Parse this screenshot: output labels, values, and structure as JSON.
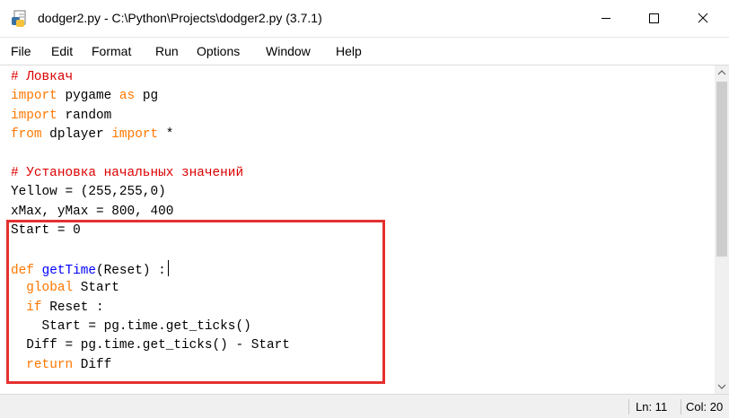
{
  "window": {
    "title": "dodger2.py - C:\\Python\\Projects\\dodger2.py (3.7.1)",
    "controls": {
      "minimize": "minimize",
      "maximize": "maximize",
      "close": "close"
    }
  },
  "menu": {
    "items": [
      "File",
      "Edit",
      "Format",
      "Run",
      "Options",
      "Window",
      "Help"
    ]
  },
  "editor": {
    "lines": [
      [
        {
          "t": "# Ловкач",
          "c": "cm"
        }
      ],
      [
        {
          "t": "import",
          "c": "kw"
        },
        {
          "t": " pygame "
        },
        {
          "t": "as",
          "c": "kw"
        },
        {
          "t": " pg"
        }
      ],
      [
        {
          "t": "import",
          "c": "kw"
        },
        {
          "t": " random"
        }
      ],
      [
        {
          "t": "from",
          "c": "kw"
        },
        {
          "t": " dplayer "
        },
        {
          "t": "import",
          "c": "kw"
        },
        {
          "t": " *"
        }
      ],
      [
        {
          "t": ""
        }
      ],
      [
        {
          "t": "# Установка начальных значений",
          "c": "cm"
        }
      ],
      [
        {
          "t": "Yellow = (255,255,0)"
        }
      ],
      [
        {
          "t": "xMax, yMax = 800, 400"
        }
      ],
      [
        {
          "t": "Start = 0"
        }
      ],
      [
        {
          "t": ""
        }
      ],
      [
        {
          "t": "def",
          "c": "kw"
        },
        {
          "t": " "
        },
        {
          "t": "getTime",
          "c": "fn"
        },
        {
          "t": "(Reset) :"
        },
        {
          "caret": true
        }
      ],
      [
        {
          "t": "  "
        },
        {
          "t": "global",
          "c": "kw"
        },
        {
          "t": " Start"
        }
      ],
      [
        {
          "t": "  "
        },
        {
          "t": "if",
          "c": "kw"
        },
        {
          "t": " Reset :"
        }
      ],
      [
        {
          "t": "    Start = pg.time.get_ticks()"
        }
      ],
      [
        {
          "t": "  Diff = pg.time.get_ticks() - Start"
        }
      ],
      [
        {
          "t": "  "
        },
        {
          "t": "return",
          "c": "kw"
        },
        {
          "t": " Diff"
        }
      ]
    ],
    "colors": {
      "keyword": "#ff7700",
      "comment": "#dd0000",
      "function": "#0000ff",
      "highlight_box": "#e53030"
    }
  },
  "status": {
    "line": "Ln: 11",
    "col": "Col: 20"
  },
  "icons": {
    "app": "idle-python-file-icon",
    "scroll_up": "chevron-up-icon",
    "scroll_down": "chevron-down-icon"
  }
}
